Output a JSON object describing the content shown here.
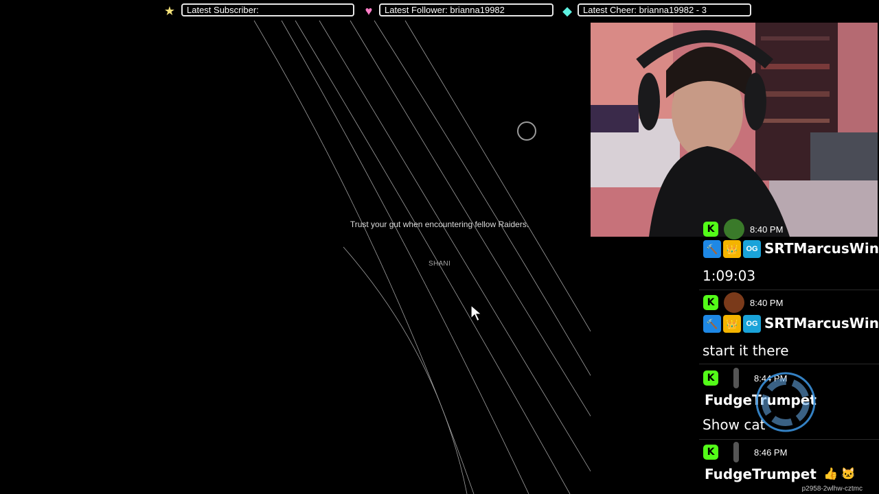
{
  "alerts": {
    "subscriber": {
      "label": "Latest Subscriber:",
      "icon": "star-icon",
      "color": "#f5e27a"
    },
    "follower": {
      "label": "Latest Follower: brianna19982",
      "icon": "heart-icon",
      "color": "#ff7fc8"
    },
    "cheer": {
      "label": "Latest Cheer: brianna19982 - 3",
      "icon": "gem-icon",
      "color": "#5ef2e2"
    }
  },
  "loading": {
    "tip": "Trust your gut when encountering fellow Raiders.",
    "author": "SHANI"
  },
  "chat": {
    "messages": [
      {
        "time": "8:40 PM",
        "username": "SRTMarcusWins",
        "text": "1:09:03"
      },
      {
        "time": "8:40 PM",
        "username": "SRTMarcusWins",
        "text": "start it there"
      },
      {
        "time": "8:44 PM",
        "username": "FudgeTrumpet",
        "text": "Show cat"
      },
      {
        "time": "8:46 PM",
        "username": "FudgeTrumpet",
        "emotes": "👍 🐱"
      }
    ],
    "badge_letter": "K",
    "moderator_badge": "🔨",
    "crown_badge": "👑",
    "og_badge": "OG",
    "accent": "#53fc18"
  },
  "watermark": "p2958-2wlhw-cztmc"
}
